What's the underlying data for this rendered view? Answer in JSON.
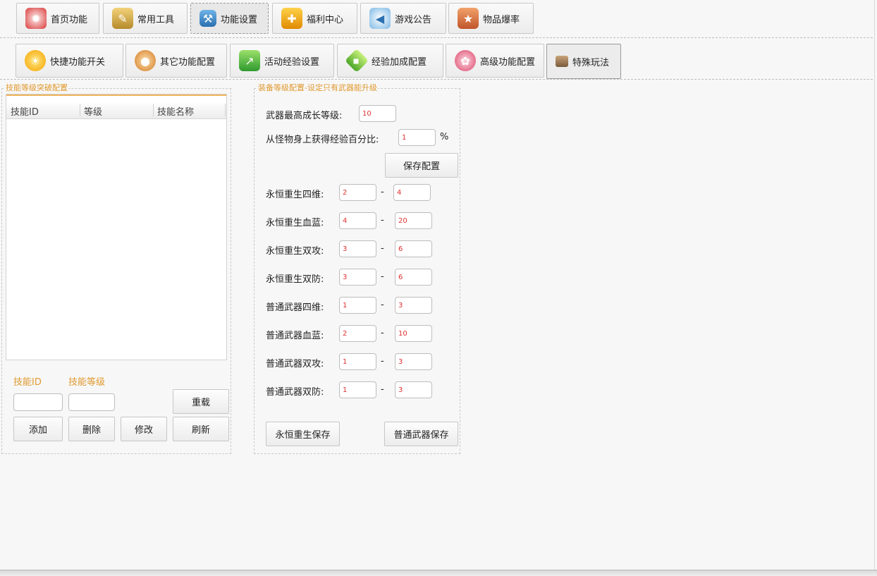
{
  "top_tabs": [
    {
      "label": "首页功能",
      "icon": "maple-leaf-icon"
    },
    {
      "label": "常用工具",
      "icon": "tools-icon"
    },
    {
      "label": "功能设置",
      "icon": "hammer-icon"
    },
    {
      "label": "福利中心",
      "icon": "gift-icon"
    },
    {
      "label": "游戏公告",
      "icon": "megaphone-icon"
    },
    {
      "label": "物品爆率",
      "icon": "scroll-icon"
    }
  ],
  "sub_tabs": [
    {
      "label": "快捷功能开关",
      "icon": "sun-icon"
    },
    {
      "label": "其它功能配置",
      "icon": "mushroom-icon"
    },
    {
      "label": "活动经验设置",
      "icon": "exp-arrow-icon"
    },
    {
      "label": "经验加成配置",
      "icon": "exp-diamond-icon"
    },
    {
      "label": "高级功能配置",
      "icon": "badge-icon"
    },
    {
      "label": "特殊玩法",
      "icon": "box-icon"
    }
  ],
  "skill_panel": {
    "legend": "技能等级突破配置",
    "columns": [
      "技能ID",
      "等级",
      "技能名称"
    ],
    "id_label": "技能ID",
    "level_label": "技能等级",
    "id_value": "",
    "level_value": "",
    "buttons": {
      "reload": "重载",
      "add": "添加",
      "delete": "删除",
      "modify": "修改",
      "refresh": "刷新"
    }
  },
  "equip_panel": {
    "legend": "装备等级配置-设定只有武器能升级",
    "max_level_label": "武器最高成长等级:",
    "max_level_value": "10",
    "exp_percent_label": "从怪物身上获得经验百分比:",
    "exp_percent_value": "1",
    "percent_sign": "%",
    "save_config": "保存配置",
    "dash": "-",
    "rows": [
      {
        "label": "永恒重生四维:",
        "min": "2",
        "max": "4"
      },
      {
        "label": "永恒重生血蓝:",
        "min": "4",
        "max": "20"
      },
      {
        "label": "永恒重生双攻:",
        "min": "3",
        "max": "6"
      },
      {
        "label": "永恒重生双防:",
        "min": "3",
        "max": "6"
      },
      {
        "label": "普通武器四维:",
        "min": "1",
        "max": "3"
      },
      {
        "label": "普通武器血蓝:",
        "min": "2",
        "max": "10"
      },
      {
        "label": "普通武器双攻:",
        "min": "1",
        "max": "3"
      },
      {
        "label": "普通武器双防:",
        "min": "1",
        "max": "3"
      }
    ],
    "save_eternal": "永恒重生保存",
    "save_normal": "普通武器保存"
  }
}
